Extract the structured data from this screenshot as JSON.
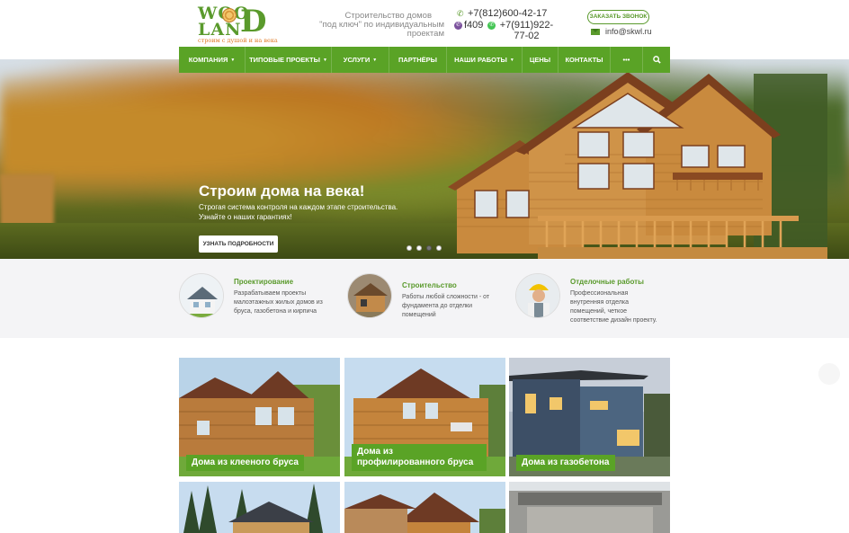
{
  "header": {
    "logo": {
      "text_top": "WOO",
      "text_bottom": "LAN",
      "letter_d": "D",
      "slogan": "строим с душой и на века"
    },
    "tagline_line1": "Строительство домов",
    "tagline_line2": "\"под ключ\" по индивидуальным проектам",
    "phone1": "+7(812)600-42-17",
    "phone2a": "f409",
    "phone2b": "+7(911)922-77-02",
    "callback_label": "ЗАКАЗАТЬ ЗВОНОК",
    "email": "info@skwl.ru"
  },
  "nav": {
    "items": [
      {
        "label": "КОМПАНИЯ",
        "dropdown": true
      },
      {
        "label": "ТИПОВЫЕ ПРОЕКТЫ",
        "dropdown": true
      },
      {
        "label": "УСЛУГИ",
        "dropdown": true
      },
      {
        "label": "ПАРТНЁРЫ",
        "dropdown": false
      },
      {
        "label": "НАШИ РАБОТЫ",
        "dropdown": true
      },
      {
        "label": "ЦЕНЫ",
        "dropdown": false
      },
      {
        "label": "КОНТАКТЫ",
        "dropdown": false
      },
      {
        "label": "•••",
        "dropdown": false
      }
    ],
    "search_icon": "search-icon"
  },
  "hero": {
    "title": "Строим дома на века!",
    "subtitle_line1": "Строгая система контроля на каждом этапе строительства.",
    "subtitle_line2": "Узнайте о наших гарантиях!",
    "button": "УЗНАТЬ ПОДРОБНОСТИ",
    "slides": 4,
    "active_slide": 3
  },
  "features": [
    {
      "title": "Проектирование",
      "text": "Разрабатываем проекты малоэтажных жилых домов из бруса, газобетона и кирпича"
    },
    {
      "title": "Строительство",
      "text": "Работы любой сложности - от фундамента до отделки помещений"
    },
    {
      "title": "Отделочные работы",
      "text": "Профессиональная внутренняя отделка помещений, четкое соответствие дизайн проекту."
    }
  ],
  "cards": [
    {
      "label": "Дома из клееного бруса"
    },
    {
      "label": "Дома из профилированного бруса"
    },
    {
      "label": "Дома из газобетона"
    }
  ],
  "colors": {
    "brand_green": "#5aa326",
    "accent_orange": "#e07b2a"
  }
}
